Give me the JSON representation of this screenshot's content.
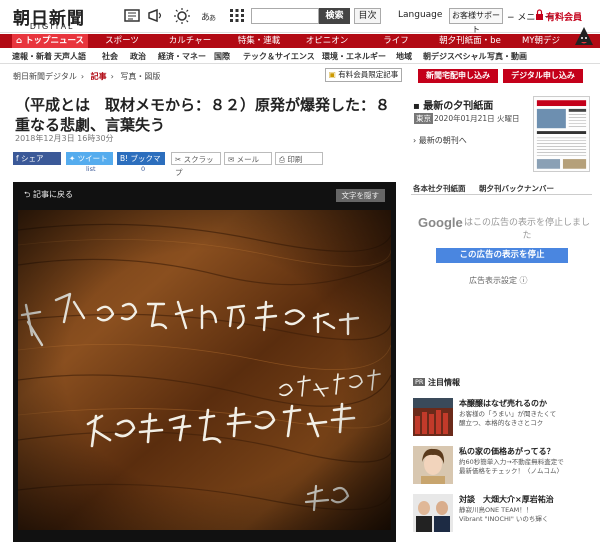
{
  "header": {
    "logo_main": "朝日新聞",
    "logo_sub": "DIGITAL",
    "search_button": "検索",
    "toc_button": "目次",
    "language": "Language",
    "support": "お客様サポート",
    "menu": "メニュー",
    "member": "有料会員"
  },
  "nav": {
    "items": [
      "トップニュース",
      "スポーツ",
      "カルチャー",
      "特集・連載",
      "オピニオン",
      "ライフ",
      "朝夕刊紙面・be",
      "MY朝デジ"
    ]
  },
  "subnav": {
    "items": [
      "速報・新着",
      "天声人語",
      "社会",
      "政治",
      "経済・マネー",
      "国際",
      "テック＆サイエンス",
      "環境・エネルギー",
      "地域",
      "朝デジスペシャル",
      "写真・動画"
    ]
  },
  "breadcrumb": {
    "items": [
      "朝日新聞デジタル",
      "記事",
      "写真・図版"
    ],
    "limited": "有料会員限定記事"
  },
  "buttons": {
    "apply": "新聞宅配申し込み",
    "digital": "デジタル申し込み"
  },
  "article": {
    "title": "（平成とは　取材メモから：８２）原発が爆発した：８重なる悲劇、言葉失う",
    "date": "2018年12月3日 16時30分"
  },
  "share": {
    "facebook": "シェア",
    "twitter": "ツイート",
    "twitter_count": "list",
    "bookmark": "ブックマーク",
    "bookmark_count": "0",
    "clip": "スクラップ",
    "mail": "メール",
    "print": "印刷"
  },
  "photo": {
    "back": "記事に戻る",
    "hide_text": "文字を隠す"
  },
  "sidebar": {
    "heading": "最新の夕刊紙面",
    "edition": "東京",
    "edition_date": "2020年01月21日 火曜日",
    "latest": "最新の朝刊へ",
    "tabs": [
      "各本社夕刊紙面",
      "朝夕刊バックナンバー"
    ]
  },
  "ad": {
    "google": "Google",
    "stop_text": "はこの広告の表示を停止しました",
    "stop_button": "この広告の表示を停止",
    "settings": "広告表示設定 ⓘ"
  },
  "attention": {
    "pr": "PR",
    "title": "注目情報",
    "items": [
      {
        "title": "本醸醸はなぜ売れるのか",
        "desc": [
          "お客様の「うまい」が聞きたくて",
          "醸立つ、本格的なきさとコク"
        ]
      },
      {
        "title": "私の家の価格あがってる？",
        "desc": [
          "約60秒簡単入力→不動産無料査定で",
          "最新価格をチェック！〈ノムコム〉"
        ]
      },
      {
        "title": "対談　大畑大介×厚岩祐治",
        "desc": [
          "静寂川鳥ONE TEAM！！",
          "Vibrant \"INOCHI\" いのち輝く"
        ]
      }
    ]
  }
}
